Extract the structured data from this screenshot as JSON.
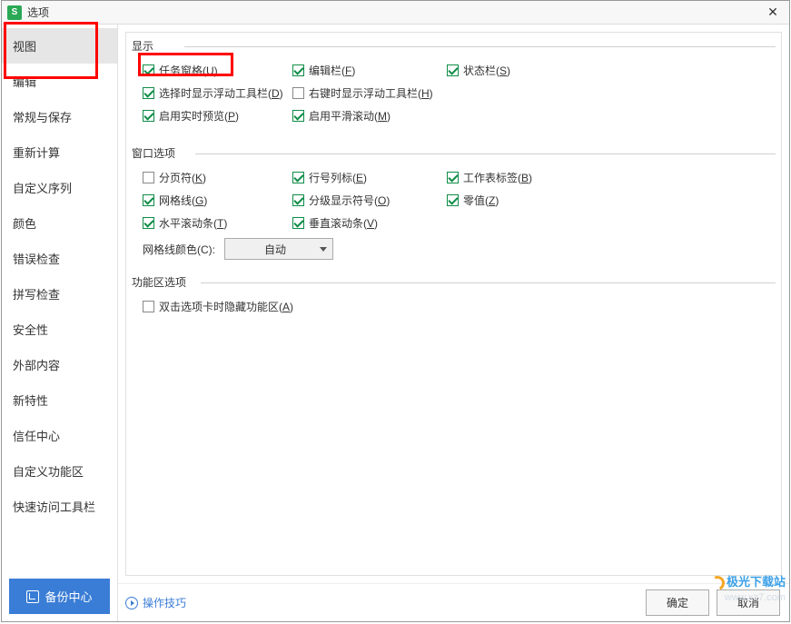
{
  "window": {
    "title": "选项",
    "app_icon_letter": "S"
  },
  "sidebar": {
    "items": [
      {
        "label": "视图",
        "selected": true
      },
      {
        "label": "编辑",
        "selected": false
      },
      {
        "label": "常规与保存",
        "selected": false
      },
      {
        "label": "重新计算",
        "selected": false
      },
      {
        "label": "自定义序列",
        "selected": false
      },
      {
        "label": "颜色",
        "selected": false
      },
      {
        "label": "错误检查",
        "selected": false
      },
      {
        "label": "拼写检查",
        "selected": false
      },
      {
        "label": "安全性",
        "selected": false
      },
      {
        "label": "外部内容",
        "selected": false
      },
      {
        "label": "新特性",
        "selected": false
      },
      {
        "label": "信任中心",
        "selected": false
      },
      {
        "label": "自定义功能区",
        "selected": false
      },
      {
        "label": "快速访问工具栏",
        "selected": false
      }
    ],
    "backup_label": "备份中心"
  },
  "sections": {
    "display": {
      "legend": "显示",
      "items": [
        {
          "label_pre": "任务窗格(",
          "hotkey": "U",
          "label_post": ")",
          "checked": true
        },
        {
          "label_pre": "编辑栏(",
          "hotkey": "F",
          "label_post": ")",
          "checked": true
        },
        {
          "label_pre": "状态栏(",
          "hotkey": "S",
          "label_post": ")",
          "checked": true
        },
        {
          "label_pre": "选择时显示浮动工具栏(",
          "hotkey": "D",
          "label_post": ")",
          "checked": true
        },
        {
          "label_pre": "右键时显示浮动工具栏(",
          "hotkey": "H",
          "label_post": ")",
          "checked": false
        },
        {
          "label_pre": "启用实时预览(",
          "hotkey": "P",
          "label_post": ")",
          "checked": true
        },
        {
          "label_pre": "启用平滑滚动(",
          "hotkey": "M",
          "label_post": ")",
          "checked": true
        }
      ]
    },
    "window_opts": {
      "legend": "窗口选项",
      "items": [
        {
          "label_pre": "分页符(",
          "hotkey": "K",
          "label_post": ")",
          "checked": false
        },
        {
          "label_pre": "行号列标(",
          "hotkey": "E",
          "label_post": ")",
          "checked": true
        },
        {
          "label_pre": "工作表标签(",
          "hotkey": "B",
          "label_post": ")",
          "checked": true
        },
        {
          "label_pre": "网格线(",
          "hotkey": "G",
          "label_post": ")",
          "checked": true
        },
        {
          "label_pre": "分级显示符号(",
          "hotkey": "O",
          "label_post": ")",
          "checked": true
        },
        {
          "label_pre": "零值(",
          "hotkey": "Z",
          "label_post": ")",
          "checked": true
        },
        {
          "label_pre": "水平滚动条(",
          "hotkey": "T",
          "label_post": ")",
          "checked": true
        },
        {
          "label_pre": "垂直滚动条(",
          "hotkey": "V",
          "label_post": ")",
          "checked": true
        }
      ],
      "grid_color_label_pre": "网格线颜色(",
      "grid_color_hotkey": "C",
      "grid_color_label_post": "):",
      "grid_color_value": "自动"
    },
    "ribbon": {
      "legend": "功能区选项",
      "items": [
        {
          "label_pre": "双击选项卡时隐藏功能区(",
          "hotkey": "A",
          "label_post": ")",
          "checked": false
        }
      ]
    }
  },
  "footer": {
    "tips_label": "操作技巧",
    "ok_label": "确定",
    "cancel_label": "取消"
  },
  "watermark": {
    "text": "极光下载站",
    "url": "www.xz7.com"
  }
}
